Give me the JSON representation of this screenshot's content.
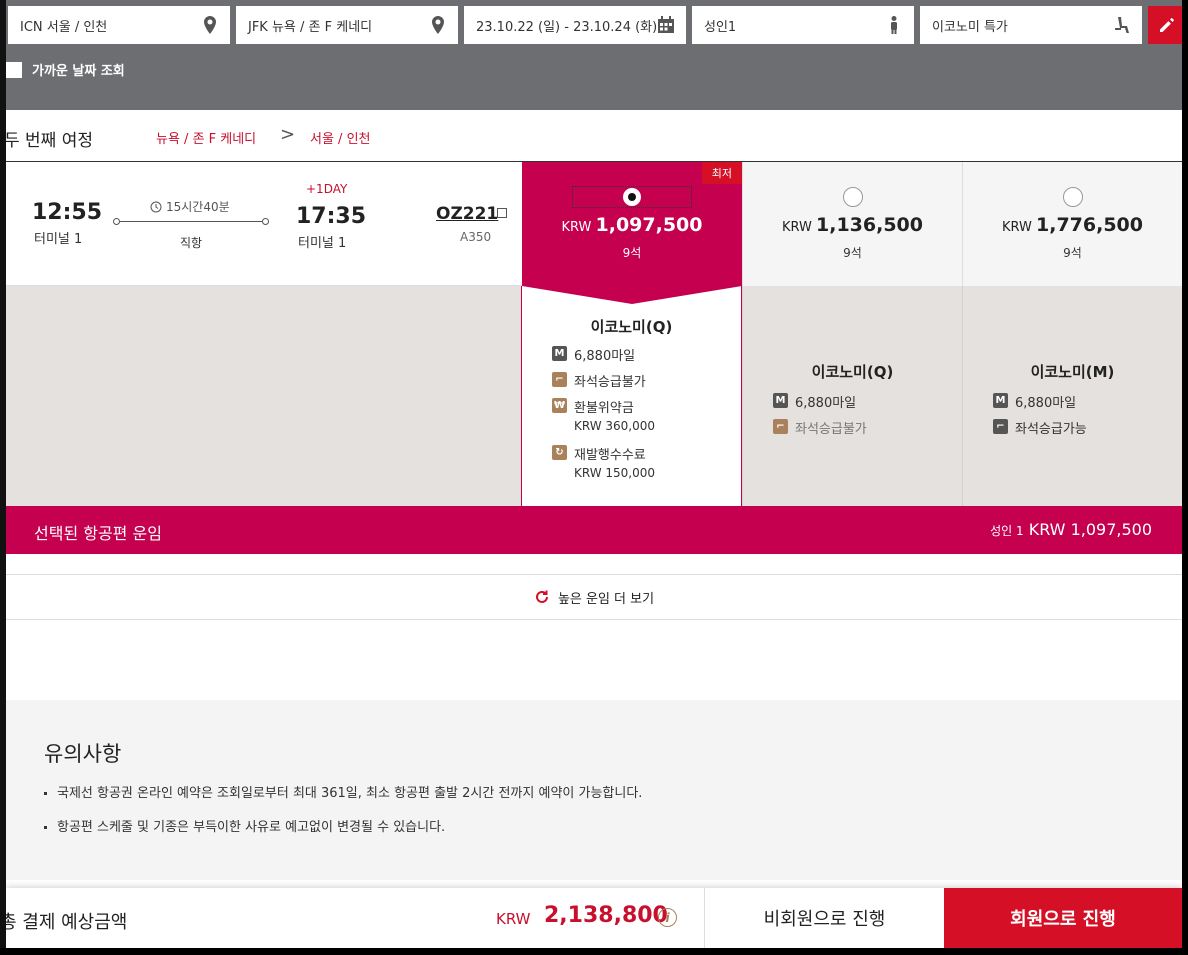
{
  "search": {
    "origin": "ICN 서울 / 인천",
    "destination": "JFK 뉴욕 / 존 F 케네디",
    "dates": "23.10.22 (일) - 23.10.24 (화)",
    "passengers": "성인1",
    "cabin": "이코노미 특가",
    "nearby_dates_label": "가까운 날짜 조회"
  },
  "route": {
    "title": "두 번째 여정",
    "from": "뉴욕 / 존 F 케네디",
    "arrow": ">",
    "to": "서울 / 인천"
  },
  "flight": {
    "dep_time": "12:55",
    "dep_terminal": "터미널 1",
    "duration": "15시간40분",
    "type": "직항",
    "plus_day": "+1DAY",
    "arr_time": "17:35",
    "arr_terminal": "터미널 1",
    "flight_no": "OZ221",
    "aircraft": "A350"
  },
  "fares": [
    {
      "currency": "KRW",
      "price": "1,097,500",
      "seats": "9석",
      "badge": "최저",
      "selected": true
    },
    {
      "currency": "KRW",
      "price": "1,136,500",
      "seats": "9석",
      "selected": false
    },
    {
      "currency": "KRW",
      "price": "1,776,500",
      "seats": "9석",
      "selected": false
    }
  ],
  "details": [
    {
      "class": "이코노미(Q)",
      "miles": "6,880마일",
      "upgrade": "좌석승급불가",
      "refund_label": "환불위약금",
      "refund_value": "KRW 360,000",
      "reissue_label": "재발행수수료",
      "reissue_value": "KRW 150,000"
    },
    {
      "class": "이코노미(Q)",
      "miles": "6,880마일",
      "upgrade": "좌석승급불가"
    },
    {
      "class": "이코노미(M)",
      "miles": "6,880마일",
      "upgrade": "좌석승급가능"
    }
  ],
  "selected_bar": {
    "label": "선택된 항공편 운임",
    "pax": "성인 1",
    "amount": "KRW 1,097,500"
  },
  "more_fares": "높은 운임 더 보기",
  "notice": {
    "title": "유의사항",
    "items": [
      "국제선 항공권 온라인 예약은 조회일로부터 최대 361일, 최소 항공편 출발 2시간 전까지 예약이 가능합니다.",
      "항공편 스케줄 및 기종은 부득이한 사유로 예고없이 변경될 수 있습니다."
    ]
  },
  "bottom": {
    "total_label": "총 결제 예상금액",
    "currency": "KRW",
    "total": "2,138,800",
    "guest_button": "비회원으로 진행",
    "member_button": "회원으로 진행"
  },
  "colors": {
    "brand_red": "#d50f25",
    "selected_magenta": "#c4004f",
    "header_gray": "#6d6e71"
  },
  "icons": [
    "location-pin-icon",
    "calendar-icon",
    "person-icon",
    "seat-icon",
    "pencil-icon",
    "clock-icon",
    "copy-icon",
    "mileage-icon",
    "upgrade-seat-icon",
    "won-icon",
    "reissue-icon",
    "refresh-icon",
    "info-icon"
  ]
}
